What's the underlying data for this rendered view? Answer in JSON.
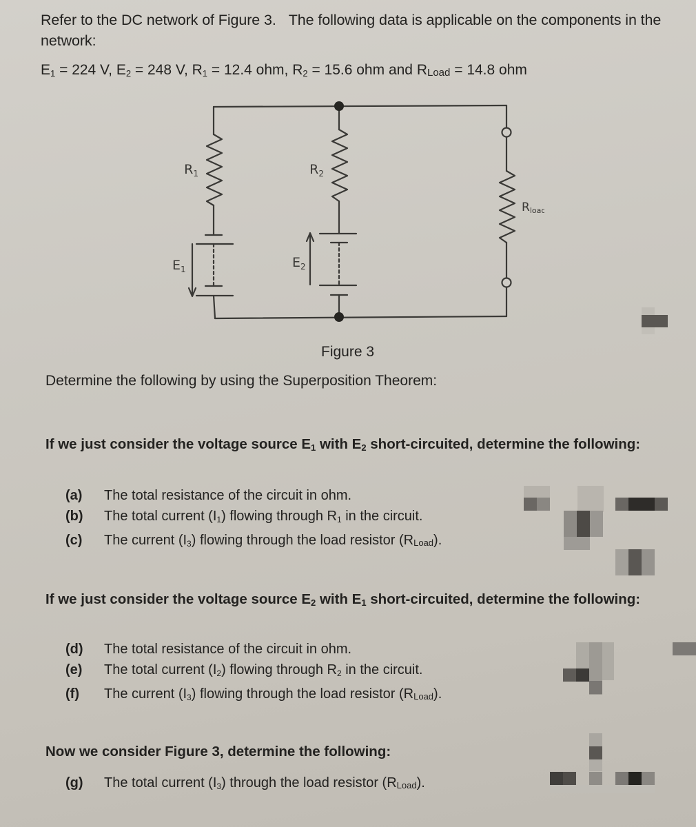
{
  "intro": {
    "sentence1": "Refer to the DC network of Figure 3.",
    "sentence2": "The following data is applicable on the components in the network:"
  },
  "params": {
    "E1": "224 V",
    "E2": "248 V",
    "R1": "12.4 ohm",
    "R2": "15.6 ohm",
    "RLoad": "14.8 ohm"
  },
  "circuit": {
    "labels": {
      "R1": "R",
      "R1_sub": "1",
      "R2": "R",
      "R2_sub": "2",
      "Rload": "R",
      "Rload_sub": "load",
      "E1": "E",
      "E1_sub": "1",
      "E2": "E",
      "E2_sub": "2"
    },
    "caption": "Figure 3"
  },
  "determine": "Determine the following by using the Superposition Theorem:",
  "sections": [
    {
      "heading_pre": "If we just consider the voltage source E",
      "heading_sub1": "1",
      "heading_mid": " with E",
      "heading_sub2": "2",
      "heading_post": " short-circuited, determine the following:",
      "questions": [
        {
          "label": "(a)",
          "text": "The total resistance of the circuit in ohm."
        },
        {
          "label": "(b)",
          "text_pre": "The total current (I",
          "sub": "1",
          "text_post": ") flowing through R",
          "sub2": "1",
          "text_end": " in the circuit."
        },
        {
          "label": "(c)",
          "text_pre": "The current (I",
          "sub": "3",
          "text_post": ") flowing through the load resistor (R",
          "sub2": "Load",
          "text_end": ")."
        }
      ]
    },
    {
      "heading_pre": "If we just consider the voltage source E",
      "heading_sub1": "2",
      "heading_mid": " with E",
      "heading_sub2": "1",
      "heading_post": " short-circuited, determine the following:",
      "questions": [
        {
          "label": "(d)",
          "text": "The total resistance of the circuit in ohm."
        },
        {
          "label": "(e)",
          "text_pre": "The total current (I",
          "sub": "2",
          "text_post": ") flowing through R",
          "sub2": "2",
          "text_end": " in the circuit."
        },
        {
          "label": "(f)",
          "text_pre": "The current (I",
          "sub": "3",
          "text_post": ") flowing through the load resistor (R",
          "sub2": "Load",
          "text_end": ")."
        }
      ]
    },
    {
      "heading_text": "Now we consider Figure 3, determine the following:",
      "questions": [
        {
          "label": "(g)",
          "text_pre": "The total current (I",
          "sub": "3",
          "text_post": ") through the load resistor (R",
          "sub2": "Load",
          "text_end": ")."
        }
      ]
    }
  ]
}
